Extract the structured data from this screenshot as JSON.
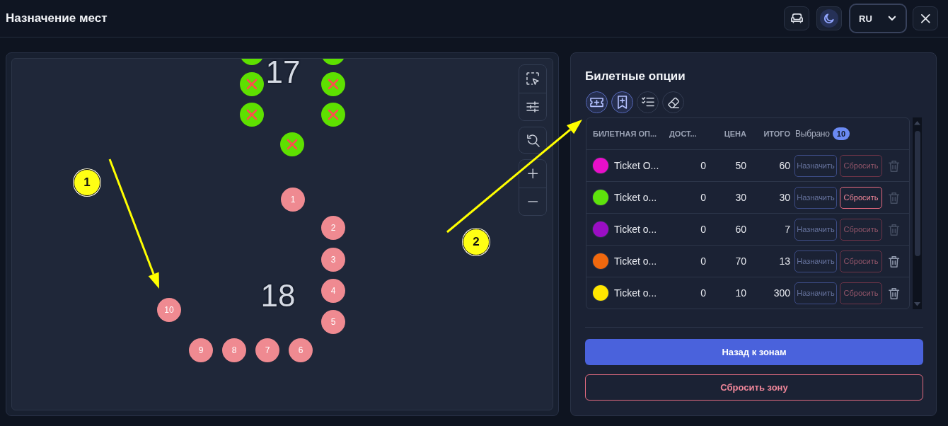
{
  "header": {
    "title": "Назначение мест",
    "controls": [
      {
        "kind": "seat-view",
        "active": false
      },
      {
        "kind": "theme",
        "active": true
      },
      {
        "kind": "language",
        "value": "RU"
      },
      {
        "kind": "close"
      }
    ]
  },
  "map": {
    "sections": [
      {
        "label": "17",
        "seats": [
          {
            "kind": "blocked",
            "color": "#5ee000"
          },
          {
            "kind": "blocked",
            "color": "#5ee000"
          },
          {
            "kind": "blocked",
            "color": "#5ee000"
          },
          {
            "kind": "blocked",
            "color": "#5ee000"
          },
          {
            "kind": "blocked",
            "color": "#5ee000"
          },
          {
            "kind": "blocked",
            "color": "#5ee000"
          },
          {
            "kind": "blocked",
            "color": "#5ee000"
          }
        ]
      },
      {
        "label": "18",
        "seats": [
          {
            "kind": "free",
            "number": "1",
            "color": "#ef8a91"
          },
          {
            "kind": "free",
            "number": "2",
            "color": "#ef8a91"
          },
          {
            "kind": "free",
            "number": "3",
            "color": "#ef8a91"
          },
          {
            "kind": "free",
            "number": "4",
            "color": "#ef8a91"
          },
          {
            "kind": "free",
            "number": "10",
            "color": "#ef8a91"
          },
          {
            "kind": "free",
            "number": "5",
            "color": "#ef8a91"
          },
          {
            "kind": "free",
            "number": "9",
            "color": "#ef8a91"
          },
          {
            "kind": "free",
            "number": "8",
            "color": "#ef8a91"
          },
          {
            "kind": "free",
            "number": "7",
            "color": "#ef8a91"
          },
          {
            "kind": "free",
            "number": "6",
            "color": "#ef8a91"
          }
        ]
      }
    ],
    "tool_groups": [
      {
        "tools": [
          {
            "kind": "select-area"
          },
          {
            "kind": "filters"
          }
        ]
      },
      {
        "tools": [
          {
            "kind": "reset-zoom"
          }
        ]
      },
      {
        "tools": [
          {
            "kind": "zoom-in"
          },
          {
            "kind": "zoom-out"
          }
        ]
      }
    ]
  },
  "annotations": [
    {
      "label": "1"
    },
    {
      "label": "2"
    }
  ],
  "ticket_panel": {
    "title": "Билетные опции",
    "tools": [
      {
        "kind": "add-ticket",
        "active": true
      },
      {
        "kind": "add-bookmark",
        "active": true
      },
      {
        "kind": "checklist",
        "active": false
      },
      {
        "kind": "eraser",
        "active": false
      }
    ],
    "table": {
      "columns": [
        "БИЛЕТНАЯ ОП...",
        "ДОСТ...",
        "ЦЕНА",
        "ИТОГО",
        "Выбрано"
      ],
      "selected_count": "10",
      "rows": [
        {
          "name": "Ticket O...",
          "color": "#e80fc9",
          "available": "0",
          "price": "50",
          "total": "60",
          "assign": "Назначить",
          "reset": "Сбросить",
          "assign_enabled": false,
          "reset_enabled": false,
          "delete_enabled": false
        },
        {
          "name": "Ticket o...",
          "color": "#5ee30c",
          "available": "0",
          "price": "30",
          "total": "30",
          "assign": "Назначить",
          "reset": "Сбросить",
          "assign_enabled": false,
          "reset_enabled": true,
          "delete_enabled": false
        },
        {
          "name": "Ticket o...",
          "color": "#9b0ec4",
          "available": "0",
          "price": "60",
          "total": "7",
          "assign": "Назначить",
          "reset": "Сбросить",
          "assign_enabled": false,
          "reset_enabled": false,
          "delete_enabled": false
        },
        {
          "name": "Ticket o...",
          "color": "#f0680e",
          "available": "0",
          "price": "70",
          "total": "13",
          "assign": "Назначить",
          "reset": "Сбросить",
          "assign_enabled": false,
          "reset_enabled": false,
          "delete_enabled": true
        },
        {
          "name": "Ticket o...",
          "color": "#ffe600",
          "available": "0",
          "price": "10",
          "total": "300",
          "assign": "Назначить",
          "reset": "Сбросить",
          "assign_enabled": false,
          "reset_enabled": false,
          "delete_enabled": true
        }
      ]
    },
    "back_button": "Назад к зонам",
    "reset_zone_button": "Сбросить зону"
  }
}
